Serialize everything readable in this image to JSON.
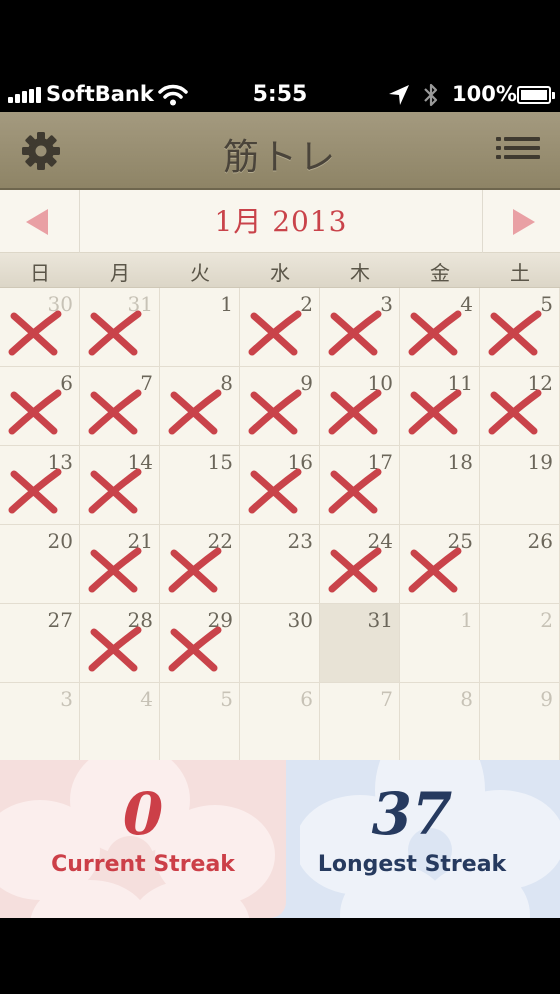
{
  "status_bar": {
    "carrier": "SoftBank",
    "time": "5:55",
    "battery": "100%"
  },
  "nav": {
    "title": "筋トレ",
    "left_icon": "gear-icon",
    "right_icon": "list-icon"
  },
  "calendar": {
    "month_label": "1月 2013",
    "weekdays": [
      "日",
      "月",
      "火",
      "水",
      "木",
      "金",
      "土"
    ],
    "weeks": [
      [
        {
          "d": "30",
          "o": true,
          "x": true
        },
        {
          "d": "31",
          "o": true,
          "x": true
        },
        {
          "d": "1",
          "o": false,
          "x": false
        },
        {
          "d": "2",
          "o": false,
          "x": true
        },
        {
          "d": "3",
          "o": false,
          "x": true
        },
        {
          "d": "4",
          "o": false,
          "x": true
        },
        {
          "d": "5",
          "o": false,
          "x": true
        }
      ],
      [
        {
          "d": "6",
          "o": false,
          "x": true
        },
        {
          "d": "7",
          "o": false,
          "x": true
        },
        {
          "d": "8",
          "o": false,
          "x": true
        },
        {
          "d": "9",
          "o": false,
          "x": true
        },
        {
          "d": "10",
          "o": false,
          "x": true
        },
        {
          "d": "11",
          "o": false,
          "x": true
        },
        {
          "d": "12",
          "o": false,
          "x": true
        }
      ],
      [
        {
          "d": "13",
          "o": false,
          "x": true
        },
        {
          "d": "14",
          "o": false,
          "x": true
        },
        {
          "d": "15",
          "o": false,
          "x": false
        },
        {
          "d": "16",
          "o": false,
          "x": true
        },
        {
          "d": "17",
          "o": false,
          "x": true
        },
        {
          "d": "18",
          "o": false,
          "x": false
        },
        {
          "d": "19",
          "o": false,
          "x": false
        }
      ],
      [
        {
          "d": "20",
          "o": false,
          "x": false
        },
        {
          "d": "21",
          "o": false,
          "x": true
        },
        {
          "d": "22",
          "o": false,
          "x": true
        },
        {
          "d": "23",
          "o": false,
          "x": false
        },
        {
          "d": "24",
          "o": false,
          "x": true
        },
        {
          "d": "25",
          "o": false,
          "x": true
        },
        {
          "d": "26",
          "o": false,
          "x": false
        }
      ],
      [
        {
          "d": "27",
          "o": false,
          "x": false
        },
        {
          "d": "28",
          "o": false,
          "x": true
        },
        {
          "d": "29",
          "o": false,
          "x": true
        },
        {
          "d": "30",
          "o": false,
          "x": false
        },
        {
          "d": "31",
          "o": false,
          "x": false,
          "today": true
        },
        {
          "d": "1",
          "o": true,
          "x": false
        },
        {
          "d": "2",
          "o": true,
          "x": false
        }
      ],
      [
        {
          "d": "3",
          "o": true,
          "x": false
        },
        {
          "d": "4",
          "o": true,
          "x": false
        },
        {
          "d": "5",
          "o": true,
          "x": false
        },
        {
          "d": "6",
          "o": true,
          "x": false
        },
        {
          "d": "7",
          "o": true,
          "x": false
        },
        {
          "d": "8",
          "o": true,
          "x": false
        },
        {
          "d": "9",
          "o": true,
          "x": false
        }
      ]
    ]
  },
  "streaks": {
    "current": {
      "value": "0",
      "label": "Current Streak"
    },
    "longest": {
      "value": "37",
      "label": "Longest Streak"
    }
  },
  "colors": {
    "accent_red": "#c9434a",
    "streak_blue": "#263a5f",
    "nav_bg": "#9a9075"
  }
}
